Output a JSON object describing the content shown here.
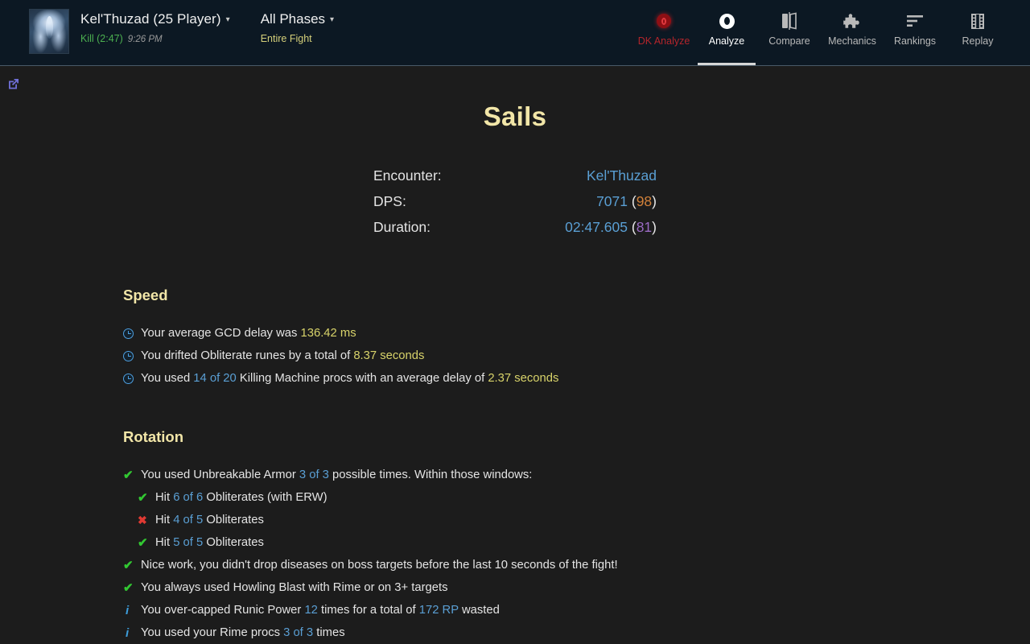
{
  "header": {
    "fight": {
      "title": "Kel'Thuzad (25 Player)",
      "caret": "▾",
      "result": "Kill (2:47)",
      "time": "9:26 PM",
      "portrait_alt": "kel-thuzad-portrait"
    },
    "phases": {
      "title": "All Phases",
      "caret": "▾",
      "subtitle": "Entire Fight"
    },
    "tabs": [
      {
        "label": "DK Analyze",
        "icon": "red-eye-icon",
        "state": "danger"
      },
      {
        "label": "Analyze",
        "icon": "white-eye-icon",
        "state": "active"
      },
      {
        "label": "Compare",
        "icon": "compare-panels-icon",
        "state": "normal"
      },
      {
        "label": "Mechanics",
        "icon": "puzzle-piece-icon",
        "state": "normal"
      },
      {
        "label": "Rankings",
        "icon": "align-left-bars-icon",
        "state": "normal"
      },
      {
        "label": "Replay",
        "icon": "film-strip-icon",
        "state": "normal"
      }
    ]
  },
  "content": {
    "external_link_icon": "external-link-icon",
    "title": "Sails",
    "summary": [
      {
        "key": "Encounter:",
        "value": "Kel'Thuzad",
        "value_style": "link-blue",
        "suffix": "",
        "suffix_style": ""
      },
      {
        "key": "DPS:",
        "value": "7071",
        "value_style": "num-blue",
        "suffix": "(98)",
        "suffix_style": "pct-orange"
      },
      {
        "key": "Duration:",
        "value": "02:47.605",
        "value_style": "num-blue",
        "suffix": "(81)",
        "suffix_style": "pct-purple"
      }
    ],
    "sections": [
      {
        "heading": "Speed",
        "bullets": [
          {
            "icon": "clock-icon",
            "indent": false,
            "parts": [
              {
                "t": "Your average GCD delay was ",
                "c": "plain"
              },
              {
                "t": "136.42 ms",
                "c": "yellow"
              }
            ]
          },
          {
            "icon": "clock-icon",
            "indent": false,
            "parts": [
              {
                "t": "You drifted Obliterate runes by a total of ",
                "c": "plain"
              },
              {
                "t": "8.37 seconds",
                "c": "yellow"
              }
            ]
          },
          {
            "icon": "clock-icon",
            "indent": false,
            "parts": [
              {
                "t": "You used ",
                "c": "plain"
              },
              {
                "t": "14 of 20",
                "c": "blue"
              },
              {
                "t": " Killing Machine procs with an average delay of ",
                "c": "plain"
              },
              {
                "t": "2.37 seconds",
                "c": "yellow"
              }
            ]
          }
        ]
      },
      {
        "heading": "Rotation",
        "bullets": [
          {
            "icon": "check-icon",
            "indent": false,
            "parts": [
              {
                "t": "You used Unbreakable Armor ",
                "c": "plain"
              },
              {
                "t": "3 of 3",
                "c": "blue"
              },
              {
                "t": " possible times. Within those windows:",
                "c": "plain"
              }
            ]
          },
          {
            "icon": "check-icon",
            "indent": true,
            "parts": [
              {
                "t": "Hit ",
                "c": "plain"
              },
              {
                "t": "6 of 6",
                "c": "blue"
              },
              {
                "t": " Obliterates (with ERW)",
                "c": "plain"
              }
            ]
          },
          {
            "icon": "x-icon",
            "indent": true,
            "parts": [
              {
                "t": "Hit ",
                "c": "plain"
              },
              {
                "t": "4 of 5",
                "c": "blue"
              },
              {
                "t": " Obliterates",
                "c": "plain"
              }
            ]
          },
          {
            "icon": "check-icon",
            "indent": true,
            "parts": [
              {
                "t": "Hit ",
                "c": "plain"
              },
              {
                "t": "5 of 5",
                "c": "blue"
              },
              {
                "t": " Obliterates",
                "c": "plain"
              }
            ]
          },
          {
            "icon": "check-icon",
            "indent": false,
            "parts": [
              {
                "t": "Nice work, you didn't drop diseases on boss targets before the last 10 seconds of the fight!",
                "c": "plain"
              }
            ]
          },
          {
            "icon": "check-icon",
            "indent": false,
            "parts": [
              {
                "t": "You always used Howling Blast with Rime or on 3+ targets",
                "c": "plain"
              }
            ]
          },
          {
            "icon": "info-icon",
            "indent": false,
            "parts": [
              {
                "t": "You over-capped Runic Power ",
                "c": "plain"
              },
              {
                "t": "12",
                "c": "blue"
              },
              {
                "t": " times for a total of ",
                "c": "plain"
              },
              {
                "t": "172 RP",
                "c": "blue"
              },
              {
                "t": " wasted",
                "c": "plain"
              }
            ]
          },
          {
            "icon": "info-icon",
            "indent": false,
            "parts": [
              {
                "t": "You used your Rime procs ",
                "c": "plain"
              },
              {
                "t": "3 of 3",
                "c": "blue"
              },
              {
                "t": " times",
                "c": "plain"
              }
            ]
          }
        ]
      }
    ]
  },
  "colors": {
    "header_bg": "#0c1823",
    "page_bg": "#1c1c1c",
    "title_gold": "#f2e6a8",
    "link_blue": "#5a9fd4",
    "accent_yellow": "#d8d36a",
    "kill_green": "#4caf50",
    "danger_red": "#b4252b",
    "check_green": "#32c832",
    "x_red": "#e03a33",
    "info_blue": "#3d9ddb",
    "orange_pct": "#d2813a",
    "purple_pct": "#9b6bc4",
    "ext_link_purple": "#6f6fd6"
  }
}
